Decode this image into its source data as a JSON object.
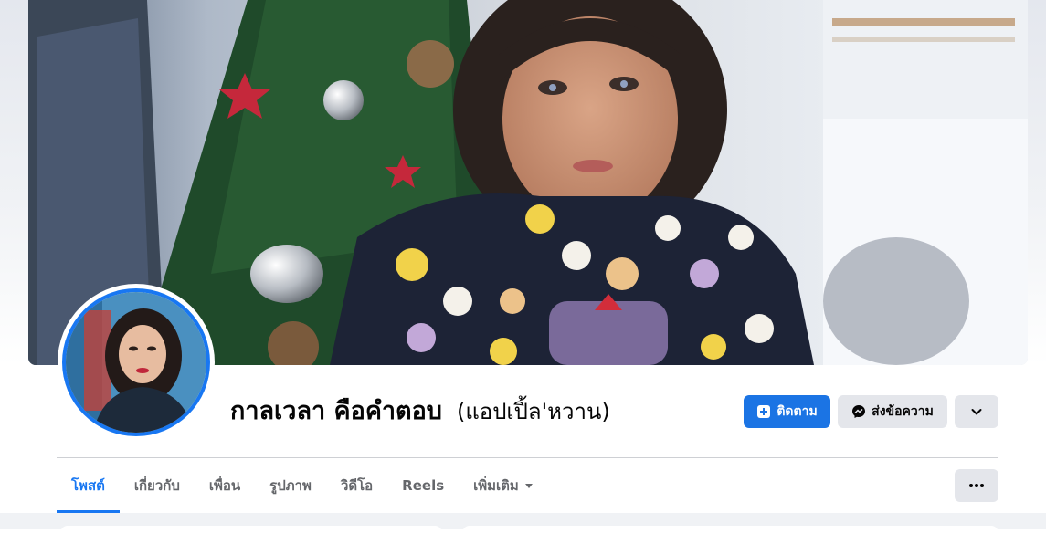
{
  "profile": {
    "name": "กาลเวลา คือคำตอบ",
    "alternate_name": "(แอปเปิ้ล'หวาน)"
  },
  "actions": {
    "follow_label": "ติดตาม",
    "message_label": "ส่งข้อความ",
    "more_icon": "chevron-down-icon"
  },
  "tabs": [
    {
      "label": "โพสต์",
      "active": true
    },
    {
      "label": "เกี่ยวกับ",
      "active": false
    },
    {
      "label": "เพื่อน",
      "active": false
    },
    {
      "label": "รูปภาพ",
      "active": false
    },
    {
      "label": "วิดีโอ",
      "active": false
    },
    {
      "label": "Reels",
      "active": false
    },
    {
      "label": "เพิ่มเติม",
      "active": false,
      "has_dropdown": true
    }
  ],
  "colors": {
    "accent": "#1877f2",
    "button_secondary": "#e4e6eb",
    "text_primary": "#050505",
    "text_secondary": "#65676b"
  }
}
